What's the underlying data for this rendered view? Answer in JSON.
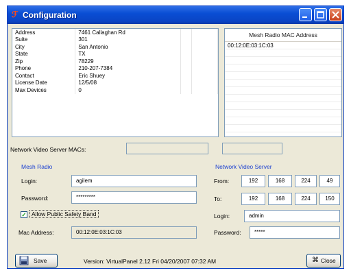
{
  "window": {
    "title": "Configuration",
    "accent": "#0a4ed4",
    "controls": [
      "minimize-icon",
      "maximize-icon",
      "close-icon"
    ]
  },
  "site_info": {
    "rows": [
      {
        "label": "Address",
        "value": "7461 Callaghan Rd"
      },
      {
        "label": "Suite",
        "value": "301"
      },
      {
        "label": "City",
        "value": "San Antonio"
      },
      {
        "label": "State",
        "value": "TX"
      },
      {
        "label": "Zip",
        "value": "78229"
      },
      {
        "label": "Phone",
        "value": "210-207-7384"
      },
      {
        "label": "Contact",
        "value": "Eric Shuey"
      },
      {
        "label": "License Date",
        "value": "12/5/08"
      },
      {
        "label": "Max Devices",
        "value": "0"
      }
    ]
  },
  "mesh_mac_list": {
    "header": "Mesh Radio MAC Address",
    "items": [
      "00:12:0E:03:1C:03"
    ]
  },
  "nvs_macs": {
    "label": "Network Video Server MACs:",
    "value1": "",
    "value2": ""
  },
  "mesh_radio": {
    "heading": "Mesh Radio",
    "login_label": "Login:",
    "login_value": "agilem",
    "password_label": "Password:",
    "password_value": "*********",
    "safety_label": "Allow Public Safety Band",
    "safety_checked": true,
    "mac_label": "Mac Address:",
    "mac_value": "00:12:0E:03:1C:03"
  },
  "nvs": {
    "heading": "Network Video Server",
    "from_label": "From:",
    "from": [
      "192",
      "168",
      "224",
      "49"
    ],
    "to_label": "To:",
    "to": [
      "192",
      "168",
      "224",
      "150"
    ],
    "login_label": "Login:",
    "login_value": "admin",
    "password_label": "Password:",
    "password_value": "*****"
  },
  "footer": {
    "save_label": "Save",
    "save_icon": "floppy-disk-icon",
    "version": "Version: VirtualPanel 2.12 Fri 04/20/2007 07:32 AM",
    "close_label": "Close",
    "close_icon": "command-key-icon"
  }
}
